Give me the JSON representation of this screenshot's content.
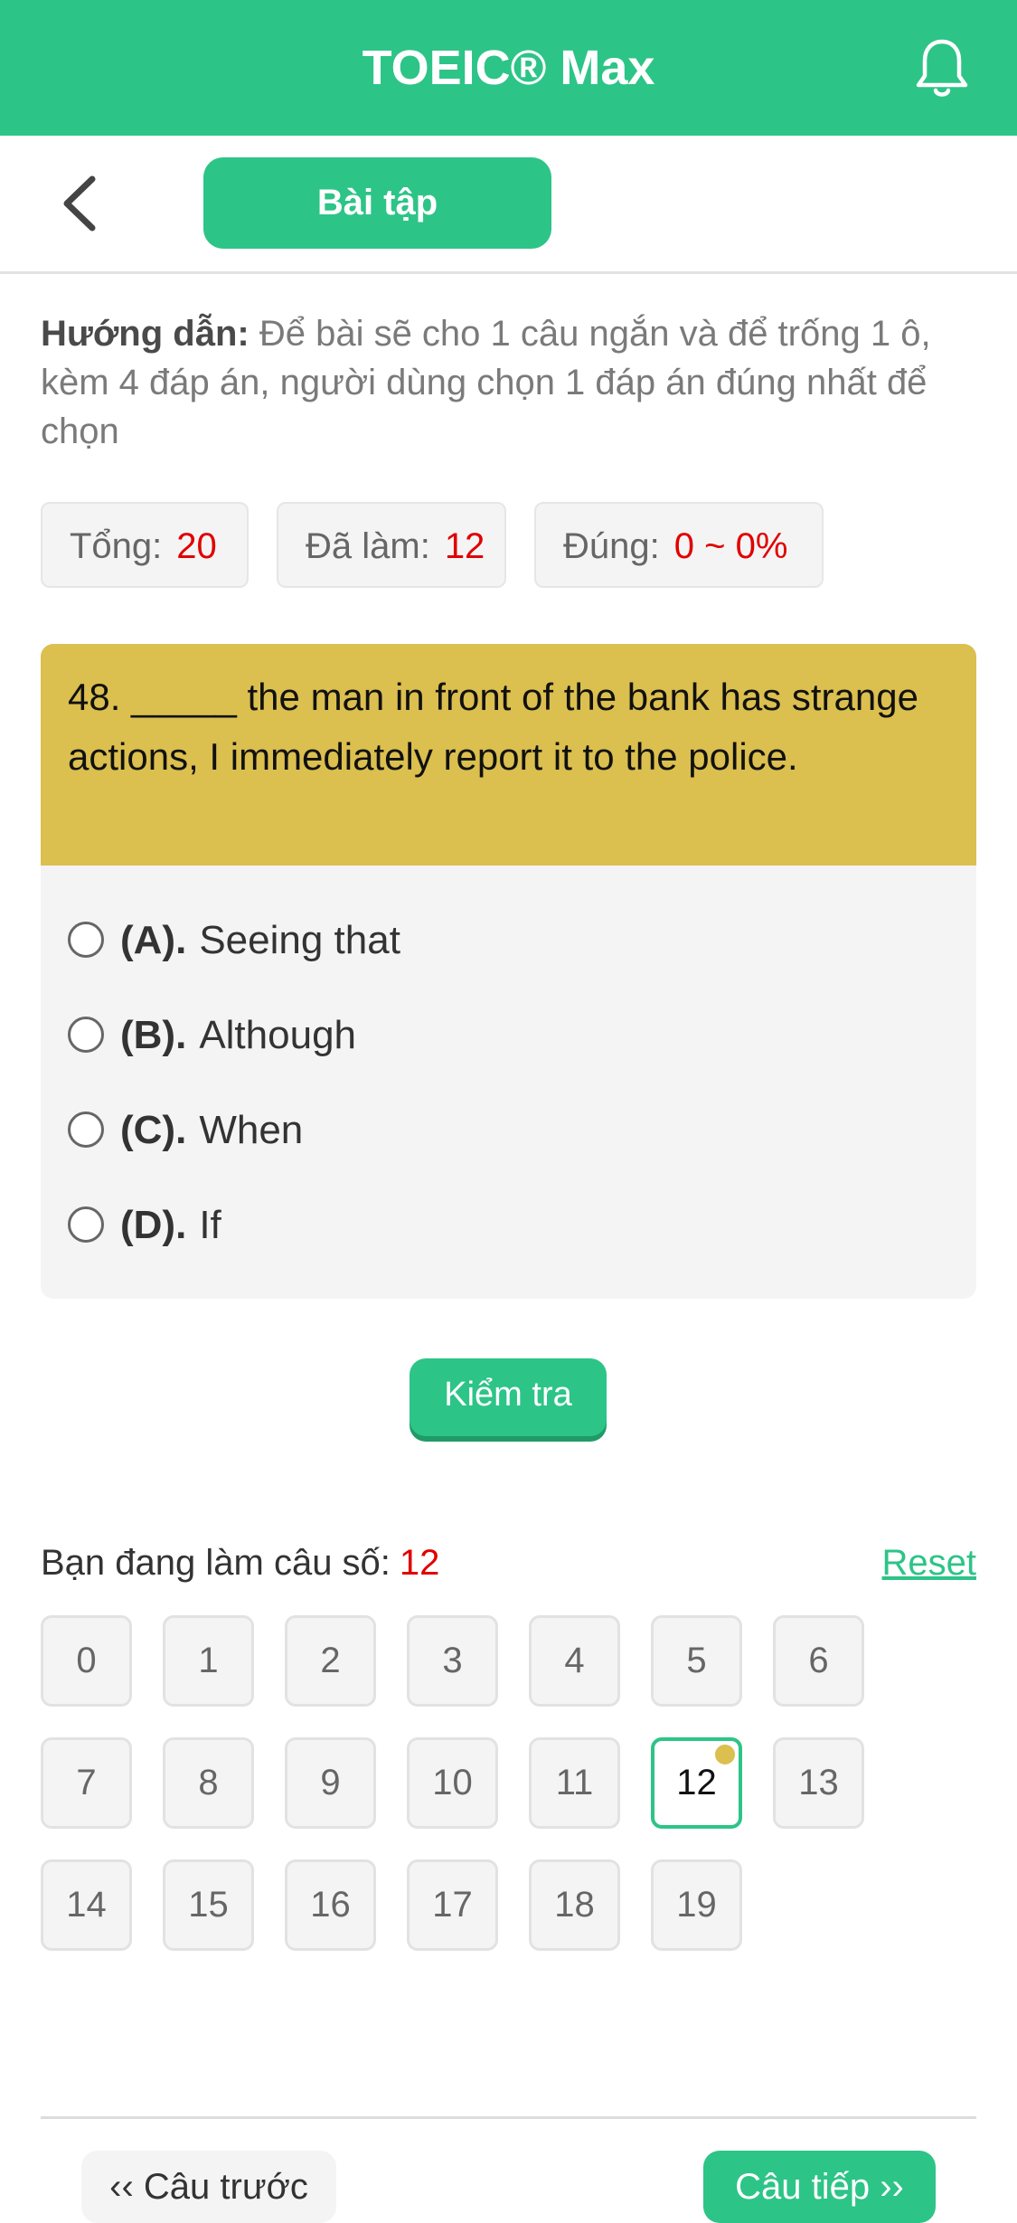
{
  "header": {
    "title": "TOEIC® Max",
    "notification_icon": "bell-icon"
  },
  "nav": {
    "back_icon": "chevron-left-icon",
    "tab_label": "Bài tập"
  },
  "instructions": {
    "label": "Hướng dẫn:",
    "text": "Để bài sẽ cho 1 câu ngắn và để trống 1 ô, kèm 4 đáp án, người dùng chọn 1 đáp án đúng nhất để chọn"
  },
  "stats": {
    "total_label": "Tổng:",
    "total_value": "20",
    "done_label": "Đã làm:",
    "done_value": "12",
    "correct_label": "Đúng:",
    "correct_value": "0 ~ 0%"
  },
  "question": {
    "text": "48. _____ the man in front of the bank has strange actions, I immediately report it to the police.",
    "options": [
      {
        "letter": "(A).",
        "text": "Seeing that"
      },
      {
        "letter": "(B).",
        "text": "Although"
      },
      {
        "letter": "(C).",
        "text": "When"
      },
      {
        "letter": "(D).",
        "text": "If"
      }
    ]
  },
  "check_button": "Kiểm tra",
  "progress": {
    "current_label": "Bạn đang làm câu số:",
    "current_value": "12",
    "reset_label": "Reset"
  },
  "question_numbers": [
    "0",
    "1",
    "2",
    "3",
    "4",
    "5",
    "6",
    "7",
    "8",
    "9",
    "10",
    "11",
    "12",
    "13",
    "14",
    "15",
    "16",
    "17",
    "18",
    "19"
  ],
  "active_question": "12",
  "footer": {
    "prev_label": "‹‹ Câu trước",
    "next_label": "Câu tiếp ››"
  },
  "colors": {
    "accent": "#2dc487",
    "question_header": "#dbbf4f",
    "highlight_value": "#e00000"
  }
}
